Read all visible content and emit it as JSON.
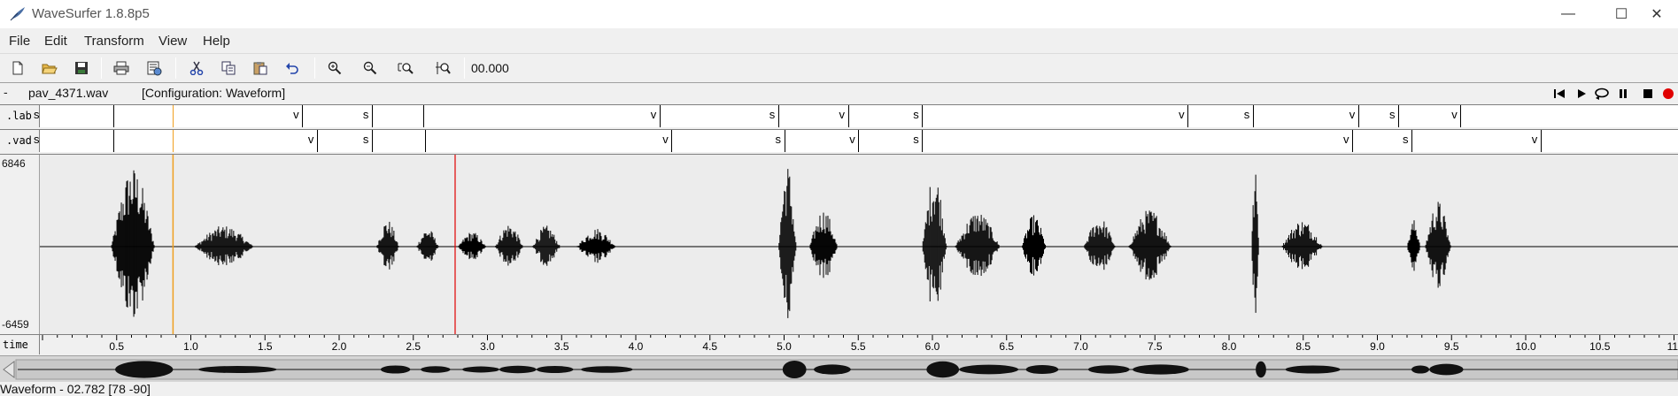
{
  "window": {
    "title": "WaveSurfer 1.8.8p5",
    "min_glyph": "—",
    "max_glyph": "☐",
    "close_glyph": "✕"
  },
  "menu": [
    "File",
    "Edit",
    "Transform",
    "View",
    "Help"
  ],
  "toolbar": {
    "time": "00.000",
    "buttons": [
      "new-file-icon",
      "open-folder-icon",
      "save-icon",
      "print-icon",
      "properties-icon",
      "cut-icon",
      "copy-icon",
      "paste-icon",
      "undo-icon",
      "zoom-in-icon",
      "zoom-out-icon",
      "zoom-fit-icon",
      "zoom-selection-icon"
    ]
  },
  "file_row": {
    "collapse": "-",
    "filename": "pav_4371.wav",
    "config": "[Configuration: Waveform]",
    "playback": [
      "skip-back-icon",
      "play-icon",
      "loop-play-icon",
      "pause-icon",
      "stop-icon",
      "record-icon"
    ]
  },
  "tiers": [
    {
      "name": ".lab",
      "segments": [
        {
          "t": 0.0,
          "label": "s"
        },
        {
          "t": 0.48,
          "label": ""
        },
        {
          "t": 1.75,
          "label": "v"
        },
        {
          "t": 2.22,
          "label": "s"
        },
        {
          "t": 2.57,
          "label": ""
        },
        {
          "t": 4.16,
          "label": "v"
        },
        {
          "t": 4.96,
          "label": "s"
        },
        {
          "t": 5.43,
          "label": "v"
        },
        {
          "t": 5.93,
          "label": "s"
        },
        {
          "t": 7.72,
          "label": "v"
        },
        {
          "t": 8.16,
          "label": "s"
        },
        {
          "t": 8.87,
          "label": "v"
        },
        {
          "t": 9.14,
          "label": "s"
        },
        {
          "t": 9.56,
          "label": "v"
        }
      ]
    },
    {
      "name": ".vad",
      "segments": [
        {
          "t": 0.0,
          "label": "s"
        },
        {
          "t": 0.48,
          "label": ""
        },
        {
          "t": 1.85,
          "label": "v"
        },
        {
          "t": 2.22,
          "label": "s"
        },
        {
          "t": 2.58,
          "label": ""
        },
        {
          "t": 4.24,
          "label": "v"
        },
        {
          "t": 5.0,
          "label": "s"
        },
        {
          "t": 5.5,
          "label": "v"
        },
        {
          "t": 5.93,
          "label": "s"
        },
        {
          "t": 8.83,
          "label": "v"
        },
        {
          "t": 9.23,
          "label": "s"
        },
        {
          "t": 10.1,
          "label": "v"
        }
      ]
    }
  ],
  "waveform": {
    "y_max_label": "6846",
    "y_min_label": "-6459",
    "cursor_time": 0.88,
    "cursor_color": "#f0a020",
    "playhead_time": 2.782,
    "playhead_color": "#e00000",
    "bursts": [
      {
        "start": 0.46,
        "end": 0.85,
        "peak": 0.95
      },
      {
        "start": 1.02,
        "end": 1.55,
        "peak": 0.25
      },
      {
        "start": 2.25,
        "end": 2.45,
        "peak": 0.32
      },
      {
        "start": 2.52,
        "end": 2.72,
        "peak": 0.22
      },
      {
        "start": 2.8,
        "end": 3.05,
        "peak": 0.18
      },
      {
        "start": 3.05,
        "end": 3.3,
        "peak": 0.28
      },
      {
        "start": 3.3,
        "end": 3.55,
        "peak": 0.25
      },
      {
        "start": 3.6,
        "end": 3.95,
        "peak": 0.22
      },
      {
        "start": 4.96,
        "end": 5.12,
        "peak": 1.0
      },
      {
        "start": 5.17,
        "end": 5.42,
        "peak": 0.45
      },
      {
        "start": 5.93,
        "end": 6.15,
        "peak": 0.9
      },
      {
        "start": 6.15,
        "end": 6.55,
        "peak": 0.42
      },
      {
        "start": 6.6,
        "end": 6.82,
        "peak": 0.38
      },
      {
        "start": 7.02,
        "end": 7.3,
        "peak": 0.35
      },
      {
        "start": 7.32,
        "end": 7.7,
        "peak": 0.45
      },
      {
        "start": 8.15,
        "end": 8.22,
        "peak": 0.9
      },
      {
        "start": 8.35,
        "end": 8.72,
        "peak": 0.32
      },
      {
        "start": 9.2,
        "end": 9.32,
        "peak": 0.32
      },
      {
        "start": 9.32,
        "end": 9.55,
        "peak": 0.55
      }
    ]
  },
  "time_axis": {
    "name": "time",
    "tick_labels": [
      "0.5",
      "1.0",
      "1.5",
      "2.0",
      "2.5",
      "3.0",
      "3.5",
      "4.0",
      "4.5",
      "5.0",
      "5.5",
      "6.0",
      "6.5",
      "7.0",
      "7.5",
      "8.0",
      "8.5",
      "9.0",
      "9.5",
      "10.0",
      "10.5",
      "11."
    ]
  },
  "status": "Waveform - 02.782 [78 -90]"
}
